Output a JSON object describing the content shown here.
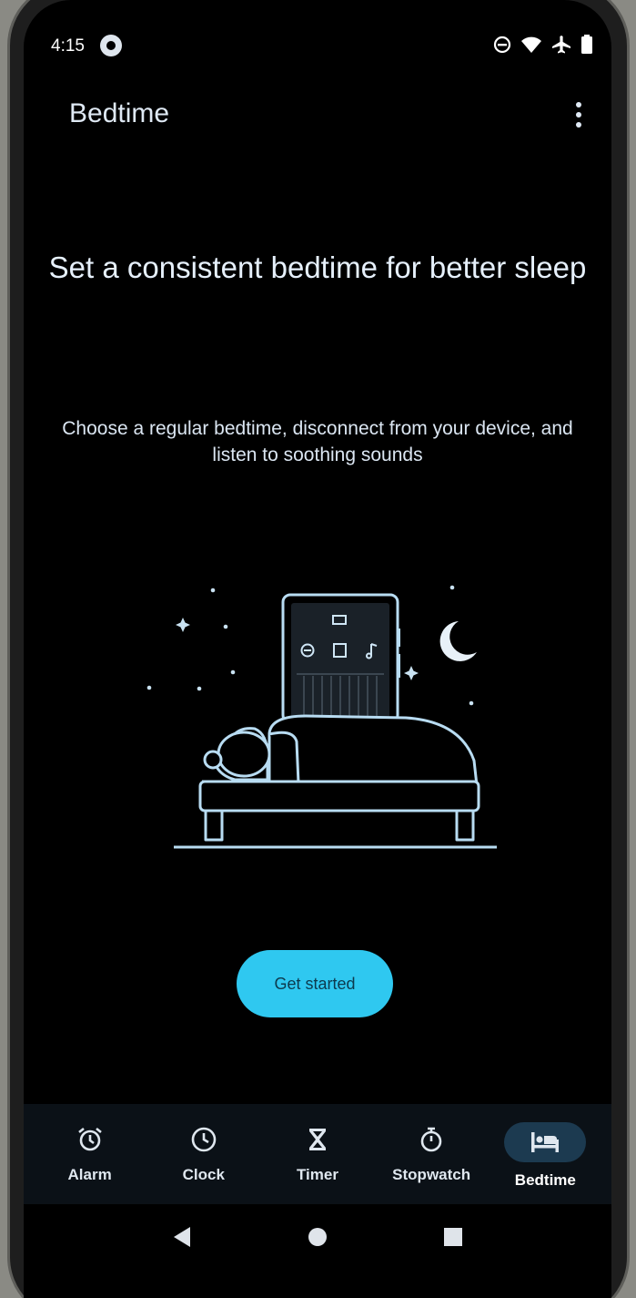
{
  "status_bar": {
    "time": "4:15",
    "icons": [
      "app-notification-icon",
      "do-not-disturb-icon",
      "wifi-icon",
      "airplane-mode-icon",
      "battery-icon"
    ]
  },
  "app_bar": {
    "title": "Bedtime",
    "menu_icon": "more-vert-icon"
  },
  "intro": {
    "headline": "Set a consistent bedtime for better sleep",
    "description": "Choose a regular bedtime, disconnect from your device, and listen to soothing sounds"
  },
  "illustration": {
    "icon": "bed-illustration",
    "phone_buttons": [
      "do-not-disturb-icon",
      "screen-off-icon",
      "music-note-icon"
    ]
  },
  "actions": {
    "get_started_label": "Get started"
  },
  "bottom_nav": {
    "items": [
      {
        "label": "Alarm",
        "icon": "alarm-icon",
        "active": false
      },
      {
        "label": "Clock",
        "icon": "clock-icon",
        "active": false
      },
      {
        "label": "Timer",
        "icon": "hourglass-icon",
        "active": false
      },
      {
        "label": "Stopwatch",
        "icon": "stopwatch-icon",
        "active": false
      },
      {
        "label": "Bedtime",
        "icon": "bed-icon",
        "active": true
      }
    ]
  },
  "system_nav": [
    "back-icon",
    "home-icon",
    "recents-icon"
  ],
  "colors": {
    "accent": "#2fc8f0",
    "background": "#000000",
    "nav_background": "#0b1117",
    "active_pill": "#1c3a50",
    "illustration_stroke": "#b8dcf2"
  }
}
